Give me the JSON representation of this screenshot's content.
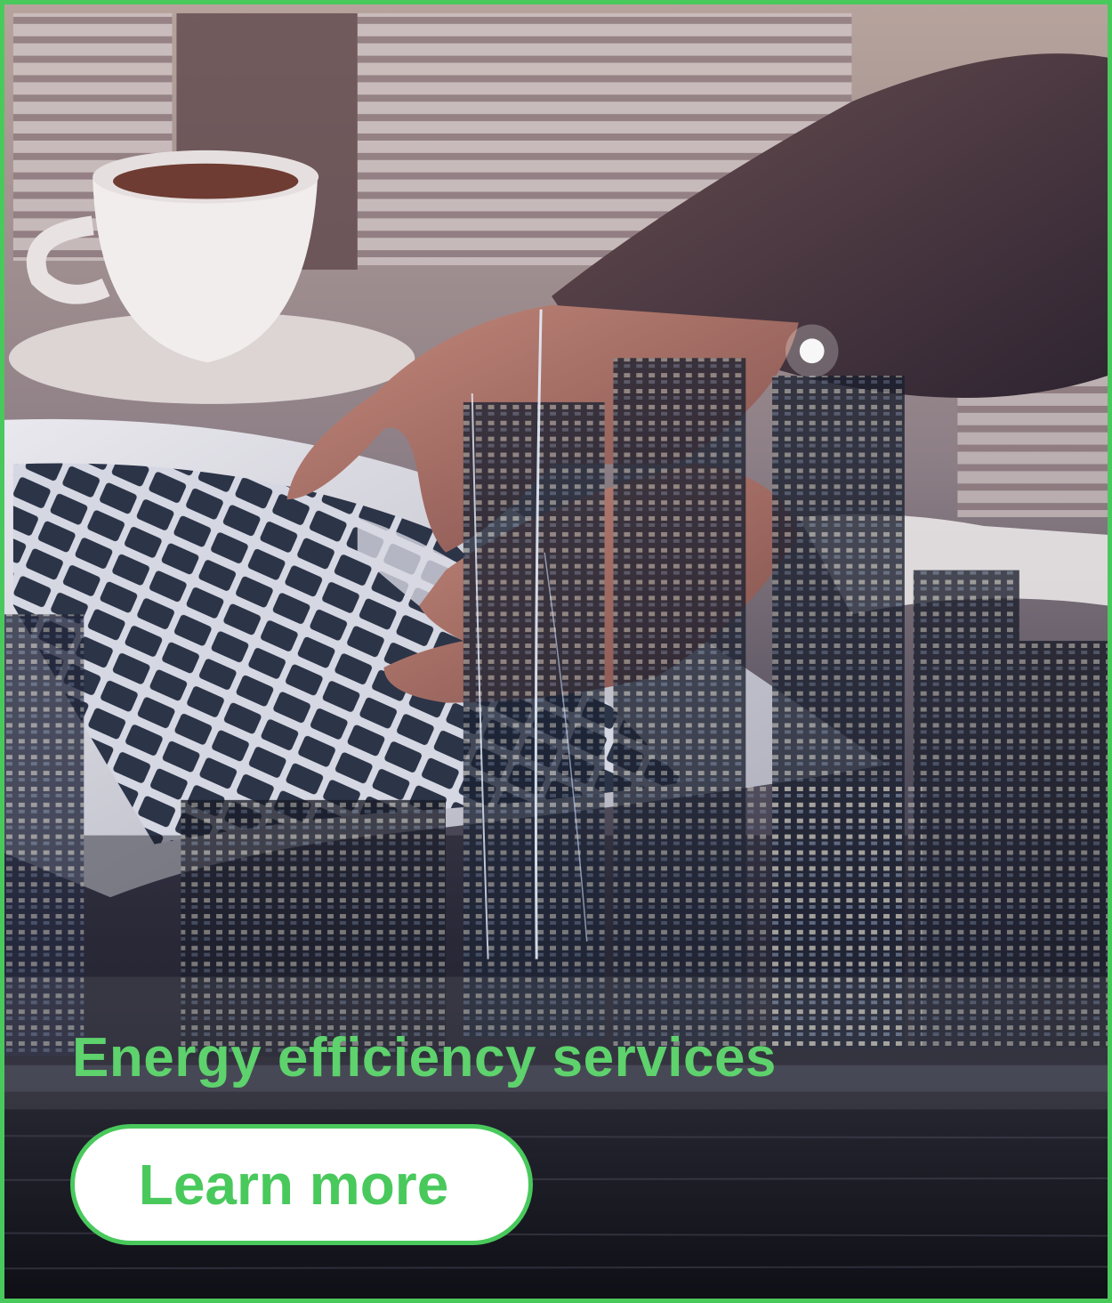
{
  "card": {
    "title": "Energy efficiency services",
    "cta_label": "Learn more"
  },
  "hero_image": {
    "icon": "laptop-city-photo",
    "accent_color": "#49c95c",
    "title_color": "#5ed26c"
  }
}
